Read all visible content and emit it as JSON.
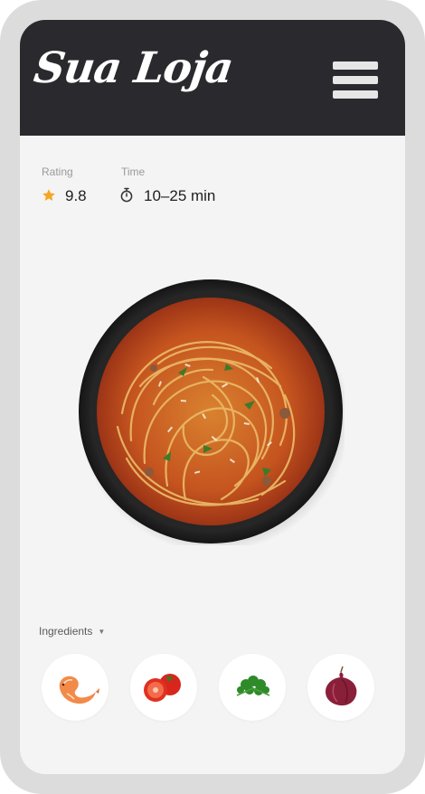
{
  "header": {
    "logo_text": "Sua Loja",
    "menu_icon": "hamburger-menu-icon"
  },
  "stats": {
    "rating": {
      "label": "Rating",
      "value": "9.8",
      "icon": "star-icon"
    },
    "time": {
      "label": "Time",
      "value": "10–25 min",
      "icon": "stopwatch-icon"
    }
  },
  "dish": {
    "icon": "spaghetti-bowl-image"
  },
  "ingredients": {
    "label": "Ingredients",
    "items": [
      {
        "icon": "shrimp-icon"
      },
      {
        "icon": "tomato-icon"
      },
      {
        "icon": "parsley-icon"
      },
      {
        "icon": "onion-icon"
      }
    ]
  },
  "colors": {
    "header_bg": "#2a2a2e",
    "accent_star": "#f5a623",
    "screen_bg": "#f4f4f4"
  }
}
